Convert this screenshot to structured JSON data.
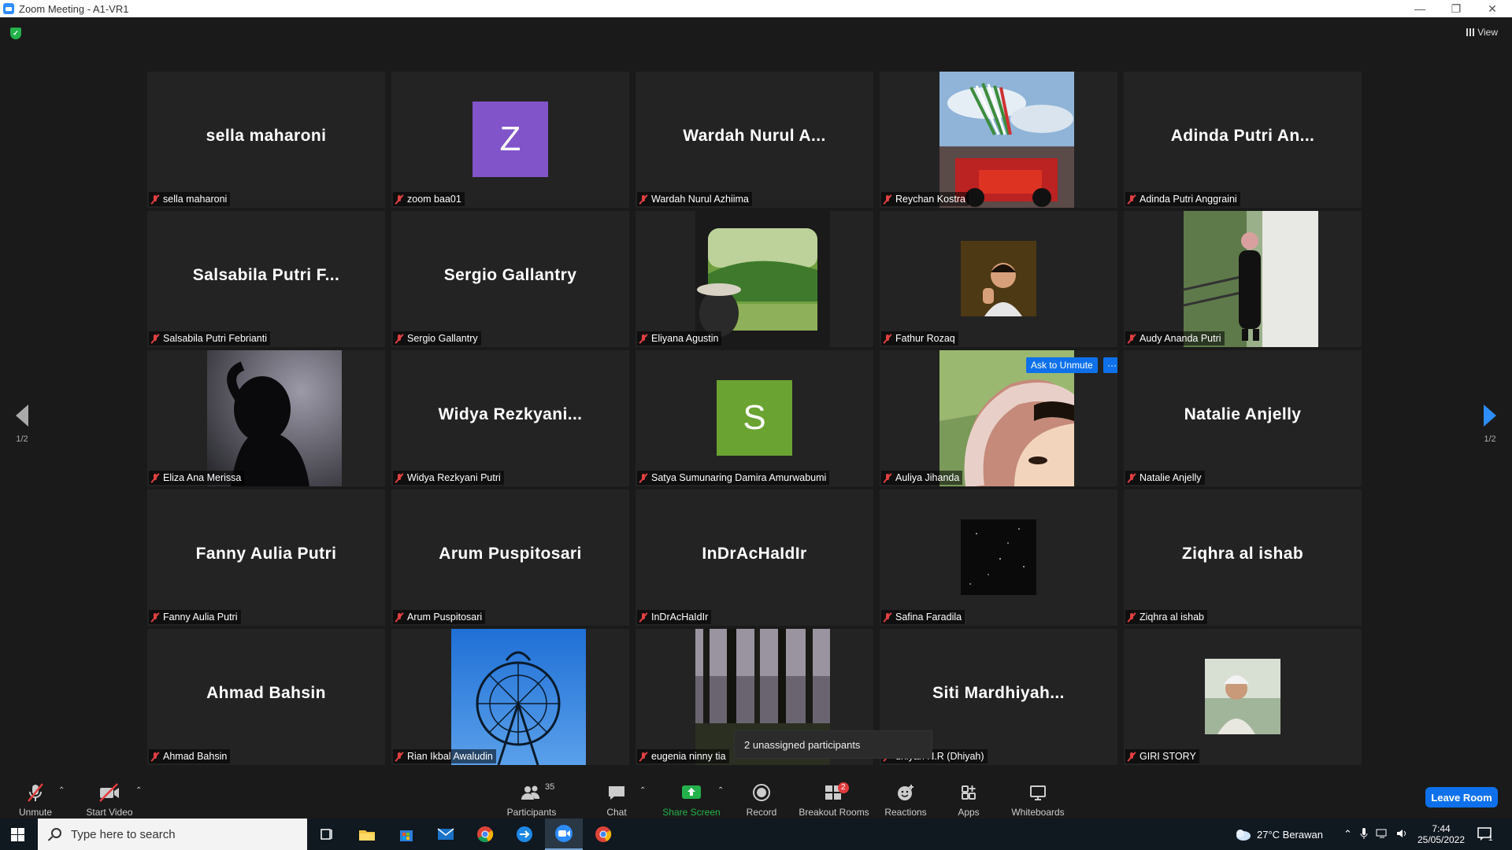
{
  "window": {
    "title": "Zoom Meeting - A1-VR1"
  },
  "top": {
    "view_label": "View"
  },
  "paging": {
    "left": "1/2",
    "right": "1/2"
  },
  "tiles": [
    {
      "big": "sella maharoni",
      "label": "sella maharoni"
    },
    {
      "avatar_letter": "Z",
      "avatar_color": "#8154c9",
      "label": "zoom baa01"
    },
    {
      "big": "Wardah Nurul A...",
      "label": "Wardah Nurul Azhiima"
    },
    {
      "photo": "photo-f1-car",
      "label": "Reychan Kostra"
    },
    {
      "big": "Adinda Putri An...",
      "label": "Adinda Putri Anggraini"
    },
    {
      "big": "Salsabila Putri F...",
      "label": "Salsabila Putri Febrianti"
    },
    {
      "big": "Sergio Gallantry",
      "label": "Sergio Gallantry"
    },
    {
      "photo": "photo-train-window",
      "label": "Eliyana Agustin"
    },
    {
      "small_photo": "photo-selfie",
      "label": "Fathur Rozaq"
    },
    {
      "photo": "photo-elevator-girl",
      "label": "Audy Ananda Putri"
    },
    {
      "photo": "photo-silhouette",
      "label": "Eliza Ana Merissa"
    },
    {
      "big": "Widya  Rezkyani...",
      "label": "Widya Rezkyani Putri"
    },
    {
      "avatar_letter": "S",
      "avatar_color": "#6aa332",
      "label": "Satya Sumunaring Damira Amurwabumi"
    },
    {
      "photo": "photo-hijab-face",
      "label": "Auliya Jihanda",
      "ask_to_unmute": "Ask to Unmute",
      "more": "···"
    },
    {
      "big": "Natalie Anjelly",
      "label": "Natalie Anjelly"
    },
    {
      "big": "Fanny Aulia Putri",
      "label": "Fanny Aulia Putri"
    },
    {
      "big": "Arum Puspitosari",
      "label": "Arum Puspitosari"
    },
    {
      "big": "InDrAcHaIdIr",
      "label": "InDrAcHaIdIr"
    },
    {
      "small_photo": "photo-night-sky",
      "label": "Safina Faradila"
    },
    {
      "big": "Ziqhra al ishab",
      "label": "Ziqhra al ishab"
    },
    {
      "big": "Ahmad Bahsin",
      "label": "Ahmad Bahsin"
    },
    {
      "photo": "photo-ferris-wheel",
      "label": "Rian Ikbal Awaludin"
    },
    {
      "photo": "photo-forest",
      "label": "eugenia ninny tia"
    },
    {
      "big": "Siti  Mardhiyah...",
      "label": "dhiyah N.R (Dhiyah)"
    },
    {
      "small_photo": "photo-worker",
      "label": "GIRI STORY"
    }
  ],
  "tooltip": "2 unassigned participants",
  "toolbar": {
    "unmute": "Unmute",
    "start_video": "Start Video",
    "participants": "Participants",
    "participants_count": "35",
    "chat": "Chat",
    "share_screen": "Share Screen",
    "record": "Record",
    "breakout_rooms": "Breakout Rooms",
    "breakout_badge": "2",
    "reactions": "Reactions",
    "apps": "Apps",
    "whiteboards": "Whiteboards",
    "leave": "Leave Room",
    "accent": "#0e71eb",
    "share_green": "#23b24b"
  },
  "taskbar": {
    "search_placeholder": "Type here to search",
    "weather": "27°C  Berawan",
    "time": "7:44",
    "date": "25/05/2022",
    "notif_count": "1"
  }
}
